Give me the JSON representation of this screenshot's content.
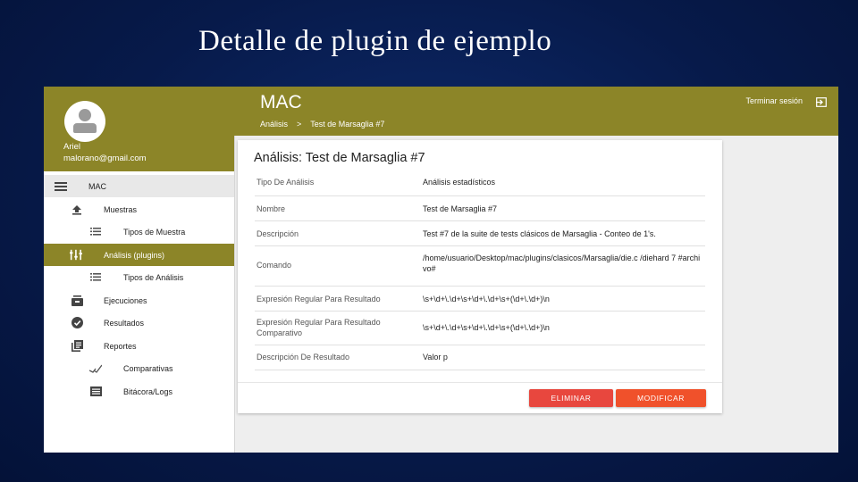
{
  "slide": {
    "title": "Detalle de plugin de ejemplo"
  },
  "user": {
    "name": "Ariel",
    "email": "malorano@gmail.com"
  },
  "sidebar": {
    "items": [
      {
        "label": "MAC",
        "icon": "menu-icon"
      },
      {
        "label": "Muestras",
        "icon": "upload-icon"
      },
      {
        "label": "Tipos de Muestra",
        "icon": "list-icon"
      },
      {
        "label": "Análisis (plugins)",
        "icon": "equalizer-icon"
      },
      {
        "label": "Tipos de Análisis",
        "icon": "list-icon"
      },
      {
        "label": "Ejecuciones",
        "icon": "queue-icon"
      },
      {
        "label": "Resultados",
        "icon": "check-circle-icon"
      },
      {
        "label": "Reportes",
        "icon": "library-books-icon"
      },
      {
        "label": "Comparativas",
        "icon": "compare-icon"
      },
      {
        "label": "Bitácora/Logs",
        "icon": "logs-icon"
      }
    ]
  },
  "header": {
    "brand": "MAC",
    "breadcrumb": [
      "Análisis",
      ">",
      "Test de Marsaglia #7"
    ],
    "logout_label": "Terminar sesión"
  },
  "card": {
    "title": "Análisis: Test de Marsaglia #7",
    "rows": [
      {
        "key": "Tipo De Análisis",
        "value": "Análisis estadísticos"
      },
      {
        "key": "Nombre",
        "value": "Test de Marsaglia #7"
      },
      {
        "key": "Descripción",
        "value": "Test #7 de la suite de tests clásicos de Marsaglia - Conteo de 1's."
      },
      {
        "key": "Comando",
        "value": "/home/usuario/Desktop/mac/plugins/clasicos/Marsaglia/die.c /diehard 7 #archivo#"
      },
      {
        "key": "Expresión Regular Para Resultado",
        "value": "\\s+\\d+\\.\\d+\\s+\\d+\\.\\d+\\s+(\\d+\\.\\d+)\\n"
      },
      {
        "key": "Expresión Regular Para Resultado Comparativo",
        "value": "\\s+\\d+\\.\\d+\\s+\\d+\\.\\d+\\s+(\\d+\\.\\d+)\\n"
      },
      {
        "key": "Descripción De Resultado",
        "value": "Valor p"
      }
    ],
    "delete_label": "ELIMINAR",
    "modify_label": "MODIFICAR"
  }
}
